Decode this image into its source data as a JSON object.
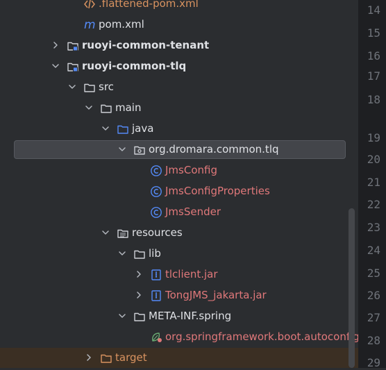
{
  "tree": {
    "items": [
      {
        "label": ".flattened-pom.xml",
        "icon": "xml-file-icon",
        "style": "orange",
        "chevron": "none"
      },
      {
        "label": "pom.xml",
        "icon": "maven-icon",
        "style": "normal",
        "chevron": "none"
      },
      {
        "label": "ruoyi-common-tenant",
        "icon": "module-folder-icon",
        "style": "bold",
        "chevron": "right"
      },
      {
        "label": "ruoyi-common-tlq",
        "icon": "module-folder-icon",
        "style": "bold",
        "chevron": "down"
      },
      {
        "label": "src",
        "icon": "folder-icon",
        "style": "normal",
        "chevron": "down"
      },
      {
        "label": "main",
        "icon": "folder-icon",
        "style": "normal",
        "chevron": "down"
      },
      {
        "label": "java",
        "icon": "source-folder-icon",
        "style": "normal",
        "chevron": "down"
      },
      {
        "label": "org.dromara.common.tlq",
        "icon": "package-icon",
        "style": "normal",
        "chevron": "down",
        "selected": true
      },
      {
        "label": "JmsConfig",
        "icon": "class-icon",
        "style": "red",
        "chevron": "none"
      },
      {
        "label": "JmsConfigProperties",
        "icon": "class-icon",
        "style": "red",
        "chevron": "none"
      },
      {
        "label": "JmsSender",
        "icon": "class-icon",
        "style": "red",
        "chevron": "none"
      },
      {
        "label": "resources",
        "icon": "resources-folder-icon",
        "style": "normal",
        "chevron": "down"
      },
      {
        "label": "lib",
        "icon": "folder-icon",
        "style": "normal",
        "chevron": "down"
      },
      {
        "label": "tlclient.jar",
        "icon": "jar-icon",
        "style": "red",
        "chevron": "right"
      },
      {
        "label": "TongJMS_jakarta.jar",
        "icon": "jar-icon",
        "style": "red",
        "chevron": "right"
      },
      {
        "label": "META-INF.spring",
        "icon": "folder-icon",
        "style": "normal",
        "chevron": "down"
      },
      {
        "label": "org.springframework.boot.autoconfig",
        "icon": "spring-icon",
        "style": "red",
        "chevron": "none"
      },
      {
        "label": "target",
        "icon": "excluded-folder-icon",
        "style": "orange",
        "chevron": "right"
      }
    ]
  },
  "gutter": {
    "lines": [
      "14",
      "15",
      "16",
      "17",
      "18",
      "19",
      "20",
      "21",
      "22",
      "23",
      "24",
      "25",
      "26",
      "27",
      "28",
      "29"
    ]
  },
  "colors": {
    "panel_bg": "#2b2d30",
    "editor_bg": "#1e1f22",
    "selection": "#43454a",
    "red_text": "#e0787a",
    "orange_text": "#d99360",
    "icon_blue": "#548af7"
  }
}
